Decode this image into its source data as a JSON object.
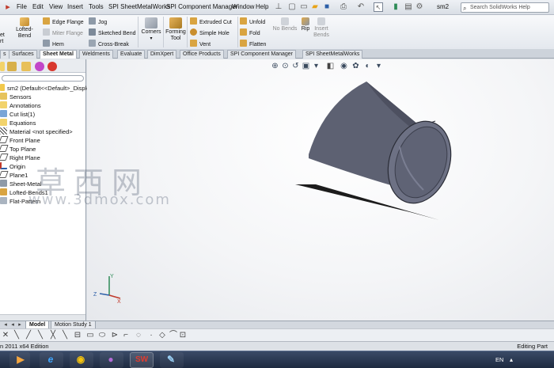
{
  "menubar": {
    "items": [
      "File",
      "Edit",
      "View",
      "Insert",
      "Tools",
      "SPI SheetMetalWorks",
      "SPI Component Manager",
      "Window",
      "Help"
    ],
    "document_title": "sm2",
    "search_placeholder": "Search SolidWorks Help"
  },
  "ribbon": {
    "cut_left_1": "et",
    "cut_left_2": "rt",
    "lofted_bend": "Lofted-Bend",
    "edge_flange": "Edge Flange",
    "miter_flange": "Miter Flange",
    "hem": "Hem",
    "jog": "Jog",
    "sketched_bend": "Sketched Bend",
    "cross_break": "Cross-Break",
    "corners": "Corners",
    "forming_tool_1": "Forming",
    "forming_tool_2": "Tool",
    "extruded_cut": "Extruded Cut",
    "simple_hole": "Simple Hole",
    "vent": "Vent",
    "unfold": "Unfold",
    "fold": "Fold",
    "flatten": "Flatten",
    "no_bends": "No Bends",
    "rip": "Rip",
    "insert_bends_1": "Insert",
    "insert_bends_2": "Bends"
  },
  "tabs": [
    "s",
    "Surfaces",
    "Sheet Metal",
    "Weldments",
    "Evaluate",
    "DimXpert",
    "Office Products",
    "SPI Component Manager",
    "SPI SheetMetalWorks"
  ],
  "tree": {
    "root": "sm2  (Default<<Default>_Disple",
    "items": [
      "Sensors",
      "Annotations",
      "Cut list(1)",
      "Equations",
      "Material <not specified>",
      "Front Plane",
      "Top Plane",
      "Right Plane",
      "Origin",
      "Plane1",
      "Sheet-Metal",
      "Lofted-Bends1",
      "Flat-Pattern"
    ]
  },
  "model_tabs": [
    "Model",
    "Motion Study 1"
  ],
  "status": {
    "left": "n 2011 x64 Edition",
    "right": "Editing Part"
  },
  "taskbar": {
    "language": "EN"
  },
  "triad": {
    "x": "X",
    "y": "Y",
    "z": "Z"
  },
  "watermark": {
    "chars": "草西网",
    "url": "www.3dmox.com"
  },
  "colors": {
    "part_body": "#5d6172",
    "part_inner": "#6d7184",
    "shadow": "#1c1c1c",
    "active_tab": "#ffffff",
    "taskbar": "#26324a"
  }
}
